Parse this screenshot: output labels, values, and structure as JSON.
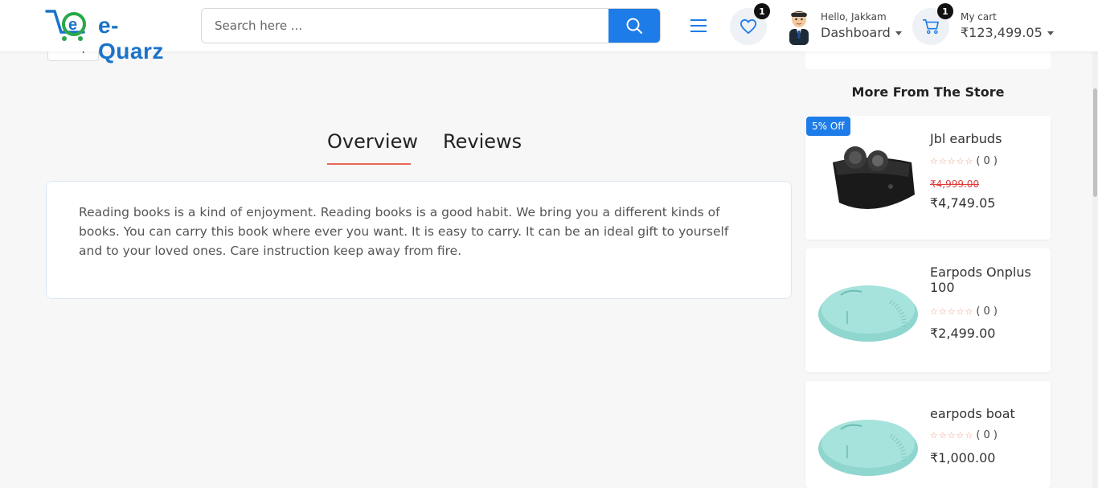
{
  "header": {
    "logo_text": "e-Quarz",
    "search_placeholder": "Search here ...",
    "wishlist_count": "1",
    "greeting": "Hello, Jakkam",
    "dashboard_label": "Dashboard",
    "cart_count": "1",
    "cart_label": "My cart",
    "cart_total": "₹123,499.05"
  },
  "tabs": [
    {
      "label": "Overview",
      "active": true
    },
    {
      "label": "Reviews",
      "active": false
    }
  ],
  "description": "Reading books is a kind of enjoyment. Reading books is a good habit. We bring you a different kinds of books. You can carry this book where ever you want. It is easy to carry. It can be an ideal gift to yourself and to your loved ones. Care instruction keep away from fire.",
  "sidebar": {
    "title": "More From The Store",
    "products": [
      {
        "badge": "5% Off",
        "name": "Jbl earbuds",
        "rating_count": "( 0 )",
        "old_price": "₹4,999.00",
        "price": "₹4,749.05"
      },
      {
        "badge": "",
        "name": "Earpods Onplus 100",
        "rating_count": "( 0 )",
        "old_price": "",
        "price": "₹2,499.00"
      },
      {
        "badge": "",
        "name": "earpods boat",
        "rating_count": "( 0 )",
        "old_price": "",
        "price": "₹1,000.00"
      }
    ]
  },
  "colors": {
    "accent": "#1e7ce8",
    "tab_underline": "#e8675a",
    "sale_price": "#e03b3b"
  }
}
